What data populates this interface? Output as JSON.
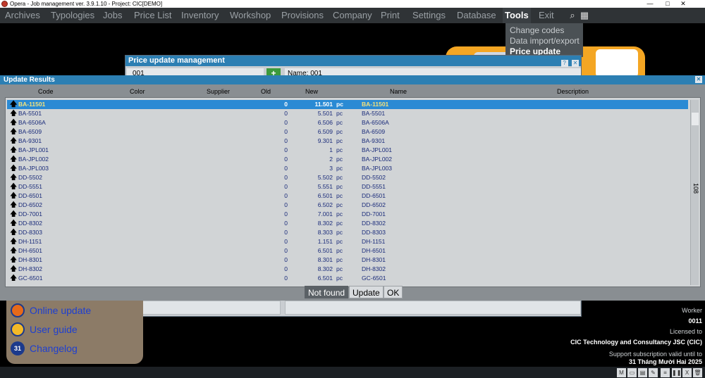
{
  "window": {
    "title": "Opera - Job management ver. 3.9.1.10 - Project: CIC[DEMO]",
    "minimize": "—",
    "maximize": "□",
    "close": "✕"
  },
  "menu": {
    "items": [
      "Archives",
      "Typologies",
      "Jobs",
      "Price List",
      "Inventory",
      "Workshop",
      "Provisions",
      "Company",
      "Print",
      "Settings",
      "Database",
      "Tools",
      "Exit"
    ],
    "active": "Tools"
  },
  "tools_menu": {
    "items": [
      "Change codes",
      "Data import/export",
      "Price update"
    ],
    "selected": "Price update"
  },
  "price_update": {
    "title": "Price update management",
    "code_value": "001",
    "name_label": "Name: 001",
    "add_symbol": "+",
    "help": "?",
    "close": "✕"
  },
  "update_results": {
    "title": "Update Results",
    "close": "✕",
    "columns": {
      "code": "Code",
      "color": "Color",
      "supplier": "Supplier",
      "old": "Old",
      "new": "New",
      "name": "Name",
      "description": "Description"
    },
    "rows": [
      {
        "code": "BA-11501",
        "old": "0",
        "new": "11.501",
        "unit": "pc",
        "name": "BA-11501"
      },
      {
        "code": "BA-5501",
        "old": "0",
        "new": "5.501",
        "unit": "pc",
        "name": "BA-5501"
      },
      {
        "code": "BA-6506A",
        "old": "0",
        "new": "6.506",
        "unit": "pc",
        "name": "BA-6506A"
      },
      {
        "code": "BA-6509",
        "old": "0",
        "new": "6.509",
        "unit": "pc",
        "name": "BA-6509"
      },
      {
        "code": "BA-9301",
        "old": "0",
        "new": "9.301",
        "unit": "pc",
        "name": "BA-9301"
      },
      {
        "code": "BA-JPL001",
        "old": "0",
        "new": "1",
        "unit": "pc",
        "name": "BA-JPL001"
      },
      {
        "code": "BA-JPL002",
        "old": "0",
        "new": "2",
        "unit": "pc",
        "name": "BA-JPL002"
      },
      {
        "code": "BA-JPL003",
        "old": "0",
        "new": "3",
        "unit": "pc",
        "name": "BA-JPL003"
      },
      {
        "code": "DD-5502",
        "old": "0",
        "new": "5.502",
        "unit": "pc",
        "name": "DD-5502"
      },
      {
        "code": "DD-5551",
        "old": "0",
        "new": "5.551",
        "unit": "pc",
        "name": "DD-5551"
      },
      {
        "code": "DD-6501",
        "old": "0",
        "new": "6.501",
        "unit": "pc",
        "name": "DD-6501"
      },
      {
        "code": "DD-6502",
        "old": "0",
        "new": "6.502",
        "unit": "pc",
        "name": "DD-6502"
      },
      {
        "code": "DD-7001",
        "old": "0",
        "new": "7.001",
        "unit": "pc",
        "name": "DD-7001"
      },
      {
        "code": "DD-8302",
        "old": "0",
        "new": "8.302",
        "unit": "pc",
        "name": "DD-8302"
      },
      {
        "code": "DD-8303",
        "old": "0",
        "new": "8.303",
        "unit": "pc",
        "name": "DD-8303"
      },
      {
        "code": "DH-1151",
        "old": "0",
        "new": "1.151",
        "unit": "pc",
        "name": "DH-1151"
      },
      {
        "code": "DH-6501",
        "old": "0",
        "new": "6.501",
        "unit": "pc",
        "name": "DH-6501"
      },
      {
        "code": "DH-8301",
        "old": "0",
        "new": "8.301",
        "unit": "pc",
        "name": "DH-8301"
      },
      {
        "code": "DH-8302",
        "old": "0",
        "new": "8.302",
        "unit": "pc",
        "name": "DH-8302"
      },
      {
        "code": "GC-6501",
        "old": "0",
        "new": "6.501",
        "unit": "pc",
        "name": "GC-6501"
      }
    ],
    "selected_index": 0,
    "count": "108",
    "buttons": {
      "not_found": "Not found",
      "update": "Update",
      "ok": "OK"
    }
  },
  "links": {
    "online_update": "Online update",
    "user_guide": "User guide",
    "changelog": "Changelog",
    "calendar_day": "31"
  },
  "info": {
    "worker_label": "Worker",
    "worker_value": "0011",
    "licensed_label": "Licensed to",
    "licensed_value": "CIC Technology and Consultancy JSC (CIC)",
    "support_label": "Support subscription valid until to",
    "support_value": "31 Tháng Mười Hai 2025"
  },
  "icons": [
    "search-icon",
    "layout-icon",
    "arrow-up-icon",
    "update-icon",
    "guide-icon",
    "calendar-icon"
  ]
}
